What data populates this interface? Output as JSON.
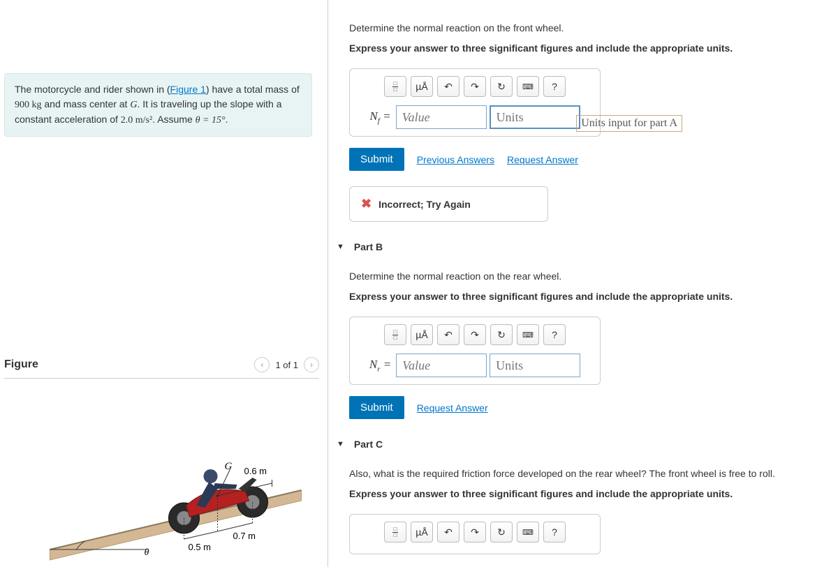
{
  "problem": {
    "text_prefix": "The motorcycle and rider shown in (",
    "figure_link": "Figure 1",
    "text_mid": ") have a total mass of ",
    "mass": "900 kg",
    "text_mass_center": " and mass center at ",
    "center_var": "G",
    "text_travel": ". It is traveling up the slope with a constant acceleration of ",
    "accel": "2.0 m/s²",
    "text_assume": ". Assume ",
    "theta_eq": "θ = 15°",
    "period": ".",
    "figure_label": "0.6 m",
    "figure_label2": "0.7 m",
    "figure_label3": "0.5 m",
    "figure_g": "G",
    "figure_theta": "θ"
  },
  "figure": {
    "title": "Figure",
    "counter": "1 of 1"
  },
  "partA": {
    "prompt": "Determine the normal reaction on the front wheel.",
    "instruction": "Express your answer to three significant figures and include the appropriate units.",
    "variable": "N_f =",
    "value_placeholder": "Value",
    "units_placeholder": "Units",
    "units_hint": "Units input for part A",
    "submit": "Submit",
    "prev_answers": "Previous Answers",
    "request_answer": "Request Answer",
    "feedback": "Incorrect; Try Again"
  },
  "partB": {
    "title": "Part B",
    "prompt": "Determine the normal reaction on the rear wheel.",
    "instruction": "Express your answer to three significant figures and include the appropriate units.",
    "variable": "N_r =",
    "value_placeholder": "Value",
    "units_placeholder": "Units",
    "submit": "Submit",
    "request_answer": "Request Answer"
  },
  "partC": {
    "title": "Part C",
    "prompt": "Also, what is the required friction force developed on the rear wheel? The front wheel is free to roll.",
    "instruction": "Express your answer to three significant figures and include the appropriate units."
  },
  "toolbar": {
    "mu_a": "µÅ",
    "question": "?"
  }
}
